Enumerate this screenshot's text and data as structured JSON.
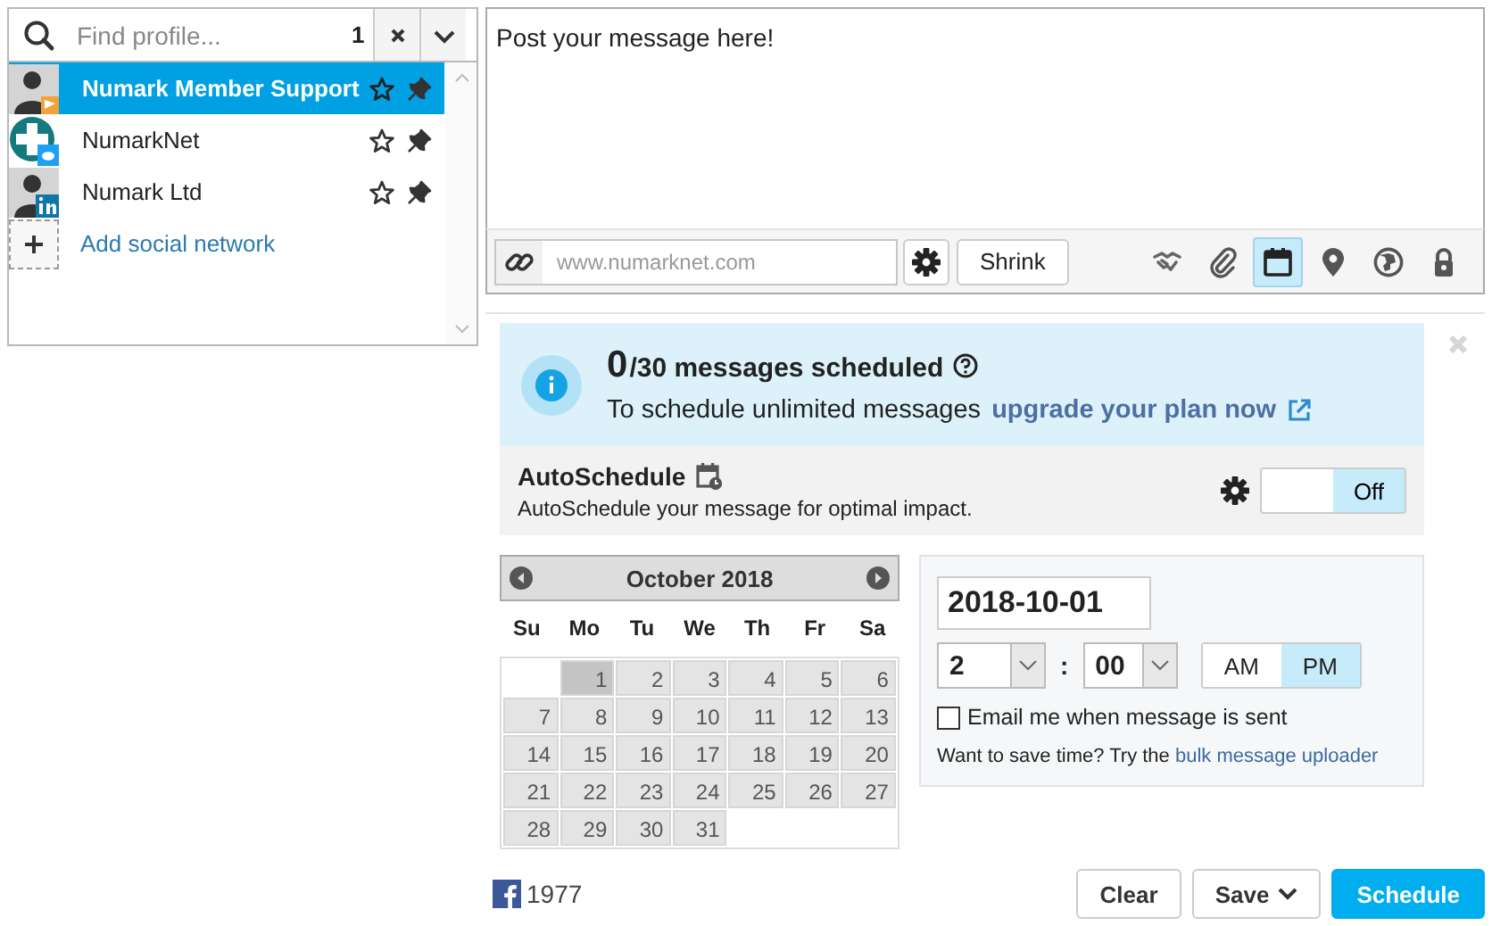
{
  "profiles": {
    "search": {
      "placeholder": "Find profile...",
      "count": "1"
    },
    "items": [
      {
        "name": "Numark Member Support",
        "avatar": {
          "kind": "person"
        },
        "badge": {
          "kind": "flag"
        },
        "selected": true
      },
      {
        "name": "NumarkNet",
        "avatar": {
          "kind": "plus"
        },
        "badge": {
          "kind": "twitter"
        },
        "selected": false
      },
      {
        "name": "Numark Ltd",
        "avatar": {
          "kind": "person"
        },
        "badge": {
          "kind": "linkedin"
        },
        "selected": false
      }
    ],
    "add_link": "Add social network"
  },
  "composer": {
    "message_placeholder": "Post your message here!",
    "url_placeholder": "www.numarknet.com",
    "shrink_button": "Shrink",
    "tools": [
      {
        "kind": "handshake",
        "selected": false
      },
      {
        "kind": "paperclip",
        "selected": false
      },
      {
        "kind": "calendar",
        "selected": true
      },
      {
        "kind": "map-pin",
        "selected": false
      },
      {
        "kind": "globe",
        "selected": false
      },
      {
        "kind": "lock",
        "selected": false
      }
    ]
  },
  "banner": {
    "count": "0",
    "total": "/30 messages scheduled",
    "text": "To schedule unlimited messages",
    "link": "upgrade your plan now"
  },
  "autoschedule": {
    "title": "AutoSchedule",
    "description": "AutoSchedule your message for optimal impact.",
    "toggle": {
      "on": false,
      "label": "Off"
    }
  },
  "calendar": {
    "month": "October 2018",
    "weekdays": [
      "Su",
      "Mo",
      "Tu",
      "We",
      "Th",
      "Fr",
      "Sa"
    ],
    "weeks": [
      [
        {
          "kind": "blank"
        },
        {
          "kind": "day",
          "label": "1",
          "selected": true
        },
        {
          "kind": "day",
          "label": "2",
          "selected": false
        },
        {
          "kind": "day",
          "label": "3",
          "selected": false
        },
        {
          "kind": "day",
          "label": "4",
          "selected": false
        },
        {
          "kind": "day",
          "label": "5",
          "selected": false
        },
        {
          "kind": "day",
          "label": "6",
          "selected": false
        }
      ],
      [
        {
          "kind": "day",
          "label": "7",
          "selected": false
        },
        {
          "kind": "day",
          "label": "8",
          "selected": false
        },
        {
          "kind": "day",
          "label": "9",
          "selected": false
        },
        {
          "kind": "day",
          "label": "10",
          "selected": false
        },
        {
          "kind": "day",
          "label": "11",
          "selected": false
        },
        {
          "kind": "day",
          "label": "12",
          "selected": false
        },
        {
          "kind": "day",
          "label": "13",
          "selected": false
        }
      ],
      [
        {
          "kind": "day",
          "label": "14",
          "selected": false
        },
        {
          "kind": "day",
          "label": "15",
          "selected": false
        },
        {
          "kind": "day",
          "label": "16",
          "selected": false
        },
        {
          "kind": "day",
          "label": "17",
          "selected": false
        },
        {
          "kind": "day",
          "label": "18",
          "selected": false
        },
        {
          "kind": "day",
          "label": "19",
          "selected": false
        },
        {
          "kind": "day",
          "label": "20",
          "selected": false
        }
      ],
      [
        {
          "kind": "day",
          "label": "21",
          "selected": false
        },
        {
          "kind": "day",
          "label": "22",
          "selected": false
        },
        {
          "kind": "day",
          "label": "23",
          "selected": false
        },
        {
          "kind": "day",
          "label": "24",
          "selected": false
        },
        {
          "kind": "day",
          "label": "25",
          "selected": false
        },
        {
          "kind": "day",
          "label": "26",
          "selected": false
        },
        {
          "kind": "day",
          "label": "27",
          "selected": false
        }
      ],
      [
        {
          "kind": "day",
          "label": "28",
          "selected": false
        },
        {
          "kind": "day",
          "label": "29",
          "selected": false
        },
        {
          "kind": "day",
          "label": "30",
          "selected": false
        },
        {
          "kind": "day",
          "label": "31",
          "selected": false
        },
        {
          "kind": "blank"
        },
        {
          "kind": "blank"
        },
        {
          "kind": "blank"
        }
      ]
    ]
  },
  "time": {
    "date": "2018-10-01",
    "hour": "2",
    "minute": "00",
    "separator": ":",
    "periods": [
      {
        "label": "AM",
        "selected": false
      },
      {
        "label": "PM",
        "selected": true
      }
    ],
    "email": {
      "label": "Email me when message is sent",
      "checked": false
    },
    "hint": "Want to save time? Try the",
    "hint_link": "bulk message uploader"
  },
  "footer": {
    "count": "1977",
    "buttons": [
      {
        "label": "Clear",
        "kind": "plain"
      },
      {
        "label": "Save",
        "kind": "menu"
      },
      {
        "label": "Schedule",
        "kind": "primary"
      }
    ]
  }
}
